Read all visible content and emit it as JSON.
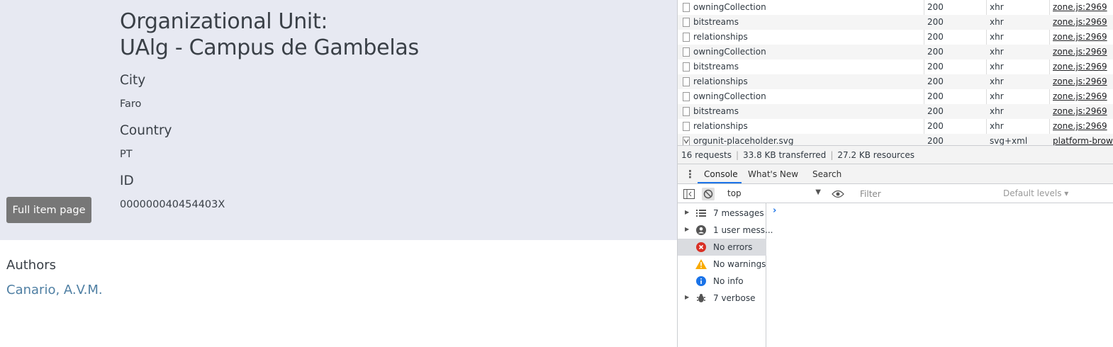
{
  "item": {
    "title_line1": "Organizational Unit:",
    "title_line2": "UAlg - Campus de Gambelas",
    "fields": [
      {
        "label": "City",
        "value": "Faro"
      },
      {
        "label": "Country",
        "value": "PT"
      },
      {
        "label": "ID",
        "value": "000000040454403X"
      }
    ],
    "full_item_button": "Full item page",
    "authors_heading": "Authors",
    "author_link": "Canario, A.V.M."
  },
  "network": {
    "rows": [
      {
        "name": "owningCollection",
        "status": "200",
        "type": "xhr",
        "initiator": "zone.js:2969",
        "icon": "checkbox-icon"
      },
      {
        "name": "bitstreams",
        "status": "200",
        "type": "xhr",
        "initiator": "zone.js:2969",
        "icon": "checkbox-icon"
      },
      {
        "name": "relationships",
        "status": "200",
        "type": "xhr",
        "initiator": "zone.js:2969",
        "icon": "checkbox-icon"
      },
      {
        "name": "owningCollection",
        "status": "200",
        "type": "xhr",
        "initiator": "zone.js:2969",
        "icon": "checkbox-icon"
      },
      {
        "name": "bitstreams",
        "status": "200",
        "type": "xhr",
        "initiator": "zone.js:2969",
        "icon": "checkbox-icon"
      },
      {
        "name": "relationships",
        "status": "200",
        "type": "xhr",
        "initiator": "zone.js:2969",
        "icon": "checkbox-icon"
      },
      {
        "name": "owningCollection",
        "status": "200",
        "type": "xhr",
        "initiator": "zone.js:2969",
        "icon": "checkbox-icon"
      },
      {
        "name": "bitstreams",
        "status": "200",
        "type": "xhr",
        "initiator": "zone.js:2969",
        "icon": "checkbox-icon"
      },
      {
        "name": "relationships",
        "status": "200",
        "type": "xhr",
        "initiator": "zone.js:2969",
        "icon": "checkbox-icon"
      },
      {
        "name": "orgunit-placeholder.svg",
        "status": "200",
        "type": "svg+xml",
        "initiator": "platform-browse",
        "icon": "svg-file-icon"
      }
    ],
    "summary": {
      "requests": "16 requests",
      "transferred": "33.8 KB transferred",
      "resources": "27.2 KB resources"
    }
  },
  "console": {
    "tabs": [
      "Console",
      "What's New",
      "Search"
    ],
    "active_tab": "Console",
    "context": "top",
    "filter_placeholder": "Filter",
    "levels_label": "Default levels ▾",
    "sidebar": [
      {
        "label": "7 messages",
        "icon": "list-icon",
        "expandable": true
      },
      {
        "label": "1 user mess...",
        "icon": "user-icon",
        "expandable": true
      },
      {
        "label": "No errors",
        "icon": "error-icon",
        "expandable": false,
        "selected": true
      },
      {
        "label": "No warnings",
        "icon": "warning-icon",
        "expandable": false
      },
      {
        "label": "No info",
        "icon": "info-icon",
        "expandable": false
      },
      {
        "label": "7 verbose",
        "icon": "bug-icon",
        "expandable": true
      }
    ],
    "prompt": "›"
  },
  "colors": {
    "hero_bg": "#e7e9f2",
    "button_bg": "#777777",
    "link": "#4f7fa3",
    "devtools_accent": "#1a73e8",
    "error": "#d93025",
    "warning": "#f9ab00",
    "info": "#1a73e8"
  }
}
